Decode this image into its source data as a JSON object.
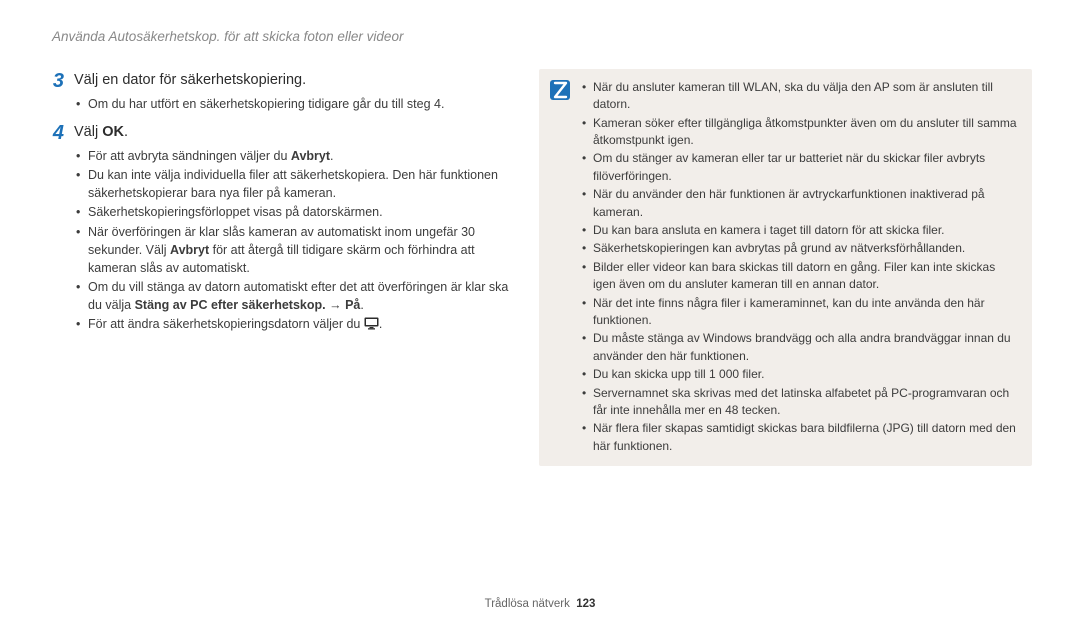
{
  "header": {
    "title": "Använda Autosäkerhetskop. för att skicka foton eller videor"
  },
  "left": {
    "steps": [
      {
        "number": "3",
        "text": "Välj en dator för säkerhetskopiering.",
        "subs": [
          "Om du har utfört en säkerhetskopiering tidigare går du till steg 4."
        ]
      },
      {
        "number": "4",
        "text_pre": "Välj ",
        "text_bold": "OK",
        "text_post": ".",
        "subs": []
      }
    ],
    "step4_bullets": {
      "b0_pre": "För att avbryta sändningen väljer du ",
      "b0_bold": "Avbryt",
      "b0_post": ".",
      "b1": "Du kan inte välja individuella filer att säkerhetskopiera. Den här funktionen säkerhetskopierar bara nya filer på kameran.",
      "b2": "Säkerhetskopieringsförloppet visas på datorskärmen.",
      "b3_pre": "När överföringen är klar slås kameran av automatiskt inom ungefär 30 sekunder. Välj ",
      "b3_bold": "Avbryt",
      "b3_post": " för att återgå till tidigare skärm och förhindra att kameran slås av automatiskt.",
      "b4_pre": "Om du vill stänga av datorn automatiskt efter det att överföringen är klar ska du välja ",
      "b4_bold": "Stäng av PC efter säkerhetskop.",
      "b4_arrow": " → ",
      "b4_bold2": "På",
      "b4_post": ".",
      "b5_pre": "För att ändra säkerhetskopieringsdatorn väljer du ",
      "b5_icon": "monitor-icon",
      "b5_post": "."
    }
  },
  "notes": [
    "När du ansluter kameran till WLAN, ska du välja den AP som är ansluten till datorn.",
    "Kameran söker efter tillgängliga åtkomstpunkter även om du ansluter till samma åtkomstpunkt igen.",
    "Om du stänger av kameran eller tar ur batteriet när du skickar filer avbryts filöverföringen.",
    "När du använder den här funktionen är avtryckarfunktionen inaktiverad på kameran.",
    "Du kan bara ansluta en kamera i taget till datorn för att skicka filer.",
    "Säkerhetskopieringen kan avbrytas på grund av nätverksförhållanden.",
    "Bilder eller videor kan bara skickas till datorn en gång. Filer kan inte skickas igen även om du ansluter kameran till en annan dator.",
    "När det inte finns några filer i kameraminnet, kan du inte använda den här funktionen.",
    "Du måste stänga av Windows brandvägg och alla andra brandväggar innan du använder den här funktionen.",
    "Du kan skicka upp till 1 000 filer.",
    "Servernamnet ska skrivas med det latinska alfabetet på PC-programvaran och får inte innehålla mer en 48 tecken.",
    "När flera filer skapas samtidigt skickas bara bildfilerna (JPG) till datorn med den här funktionen."
  ],
  "footer": {
    "section": "Trådlösa nätverk",
    "page": "123"
  }
}
